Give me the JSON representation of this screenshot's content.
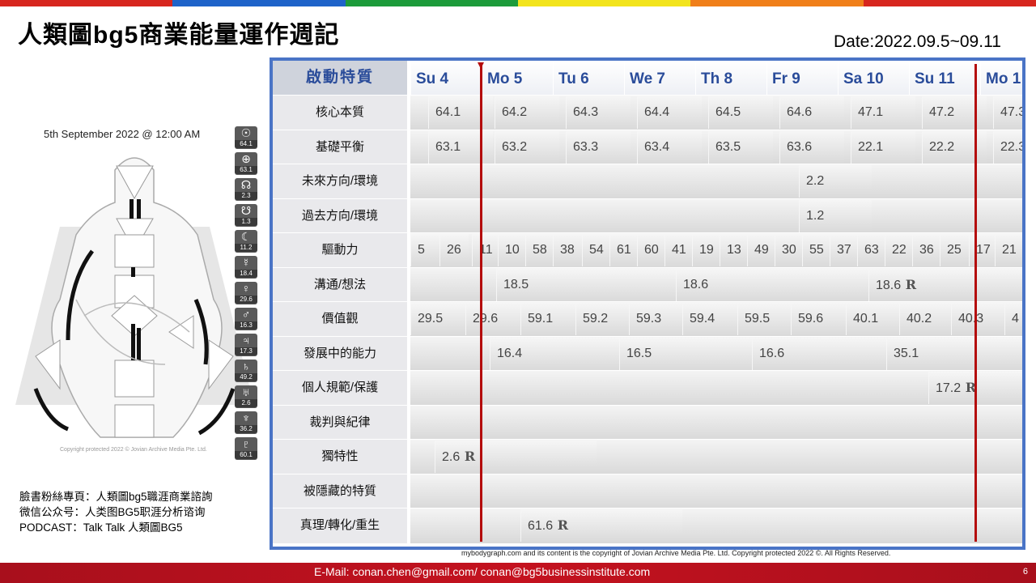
{
  "rainbow_colors": [
    "#d7261e",
    "#1e63c9",
    "#1c9b3a",
    "#f2e41d",
    "#f07f1a",
    "#d7261e"
  ],
  "title": "人類圖bg5商業能量運作週記",
  "date": "Date:2022.09.5~09.11",
  "bodygraph": {
    "date_label": "5th September 2022 @ 12:00 AM",
    "copyright_small": "Copyright protected 2022 © Jovian Archive Media Pte. Ltd.",
    "planets": [
      {
        "icon": "sun-icon",
        "sym": "☉",
        "val": "64.1"
      },
      {
        "icon": "earth-icon",
        "sym": "⊕",
        "val": "63.1"
      },
      {
        "icon": "north-node-icon",
        "sym": "☊",
        "val": "2.3"
      },
      {
        "icon": "south-node-icon",
        "sym": "☋",
        "val": "1.3"
      },
      {
        "icon": "moon-icon",
        "sym": "☾",
        "val": "11.2"
      },
      {
        "icon": "mercury-icon",
        "sym": "☿",
        "val": "18.4"
      },
      {
        "icon": "venus-icon",
        "sym": "♀",
        "val": "29.6"
      },
      {
        "icon": "mars-icon",
        "sym": "♂",
        "val": "16.3"
      },
      {
        "icon": "jupiter-icon",
        "sym": "♃",
        "val": "17.3"
      },
      {
        "icon": "saturn-icon",
        "sym": "♄",
        "val": "49.2"
      },
      {
        "icon": "uranus-icon",
        "sym": "♅",
        "val": "2.6"
      },
      {
        "icon": "neptune-icon",
        "sym": "♆",
        "val": "36.2"
      },
      {
        "icon": "pluto-icon",
        "sym": "♇",
        "val": "60.1"
      }
    ]
  },
  "notes": [
    "臉書粉絲專頁：人類圖bg5職涯商業諮詢",
    "微信公众号：人类图BG5职涯分析谘询",
    "PODCAST：Talk Talk 人類圖BG5"
  ],
  "table": {
    "header_label": "啟動特質",
    "days": [
      "Su 4",
      "Mo 5",
      "Tu 6",
      "We 7",
      "Th 8",
      "Fr 9",
      "Sa 10",
      "Su 11",
      "Mo 1"
    ],
    "rows": [
      "核心本質",
      "基礎平衡",
      "未來方向/環境",
      "過去方向/環境",
      "驅動力",
      "溝通/想法",
      "價值觀",
      "發展中的能力",
      "個人規範/保護",
      "裁判與紀律",
      "獨特性",
      "被隱藏的特質",
      "真理/轉化/重生"
    ],
    "cells": {
      "core": [
        "64.1",
        "64.2",
        "64.3",
        "64.4",
        "64.5",
        "64.6",
        "47.1",
        "47.2",
        "47.3"
      ],
      "base": [
        "63.1",
        "63.2",
        "63.3",
        "63.4",
        "63.5",
        "63.6",
        "22.1",
        "22.2",
        "22.3"
      ],
      "future": "2.2",
      "past": "1.2",
      "drive": [
        "5",
        "26",
        "11",
        "10",
        "58",
        "38",
        "54",
        "61",
        "60",
        "41",
        "19",
        "13",
        "49",
        "30",
        "55",
        "37",
        "63",
        "22",
        "36",
        "25",
        "17",
        "21"
      ],
      "comm": [
        "18.5",
        "18.6",
        "18.6"
      ],
      "values": [
        "29.5",
        "29.6",
        "59.1",
        "59.2",
        "59.3",
        "59.4",
        "59.5",
        "59.6",
        "40.1",
        "40.2",
        "40.3",
        "4"
      ],
      "develop": [
        "16.4",
        "16.5",
        "16.6",
        "35.1"
      ],
      "protect": "17.2",
      "unique": "2.6",
      "truth": "61.6"
    }
  },
  "copyright": "mybodygraph.com and its content is the copyright of Jovian Archive Media Pte. Ltd. Copyright protected 2022 ©. All Rights Reserved.",
  "footer": {
    "email": "E-Mail: conan.chen@gmail.com/  conan@bg5businessinstitute.com",
    "page": "6"
  }
}
